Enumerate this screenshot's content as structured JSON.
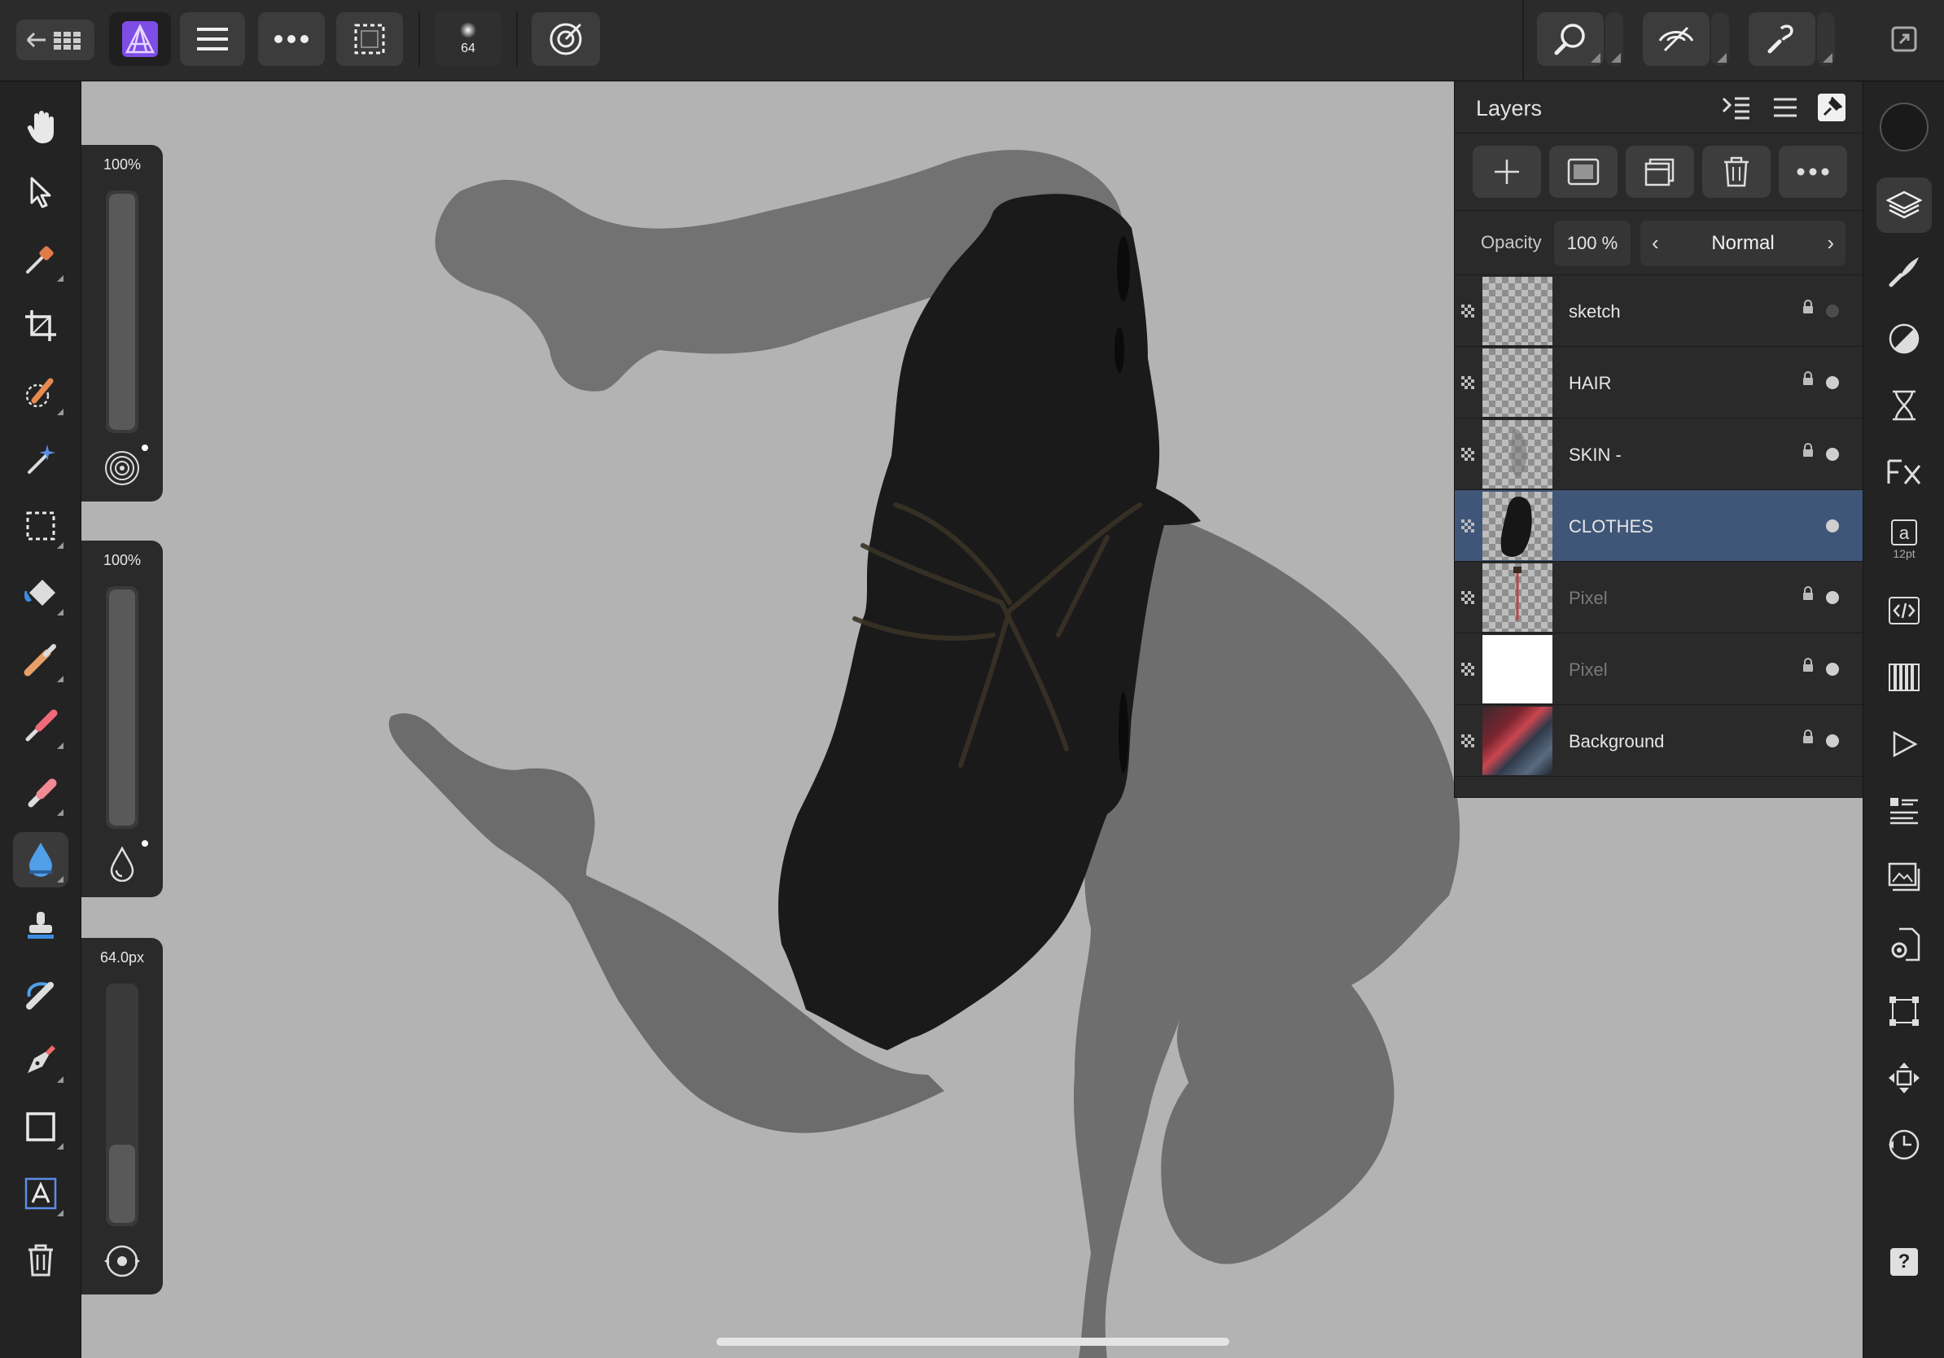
{
  "toolbar": {
    "brush_size_badge": "64",
    "accent": "#7d4de6"
  },
  "sliders": {
    "opacity_label": "100%",
    "flow_label": "100%",
    "width_label": "64.0px",
    "opacity_level": 1.0,
    "flow_level": 1.0,
    "width_level": 0.33
  },
  "layers_panel": {
    "title": "Layers",
    "opacity_label": "Opacity",
    "opacity_value": "100 %",
    "blend_mode": "Normal",
    "selected_color": "#3f5678",
    "layers": [
      {
        "name": "sketch",
        "locked": true,
        "visible": false,
        "dimmed": false
      },
      {
        "name": "HAIR",
        "locked": true,
        "visible": true,
        "dimmed": false
      },
      {
        "name": "SKIN -",
        "locked": true,
        "visible": true,
        "dimmed": false
      },
      {
        "name": "CLOTHES",
        "locked": false,
        "visible": true,
        "dimmed": false,
        "selected": true
      },
      {
        "name": "Pixel",
        "locked": true,
        "visible": true,
        "dimmed": true
      },
      {
        "name": "Pixel",
        "locked": true,
        "visible": true,
        "dimmed": true
      },
      {
        "name": "Background",
        "locked": true,
        "visible": true,
        "dimmed": false
      }
    ]
  },
  "right_tools": {
    "text_size_label": "12pt",
    "help_label": "?"
  }
}
